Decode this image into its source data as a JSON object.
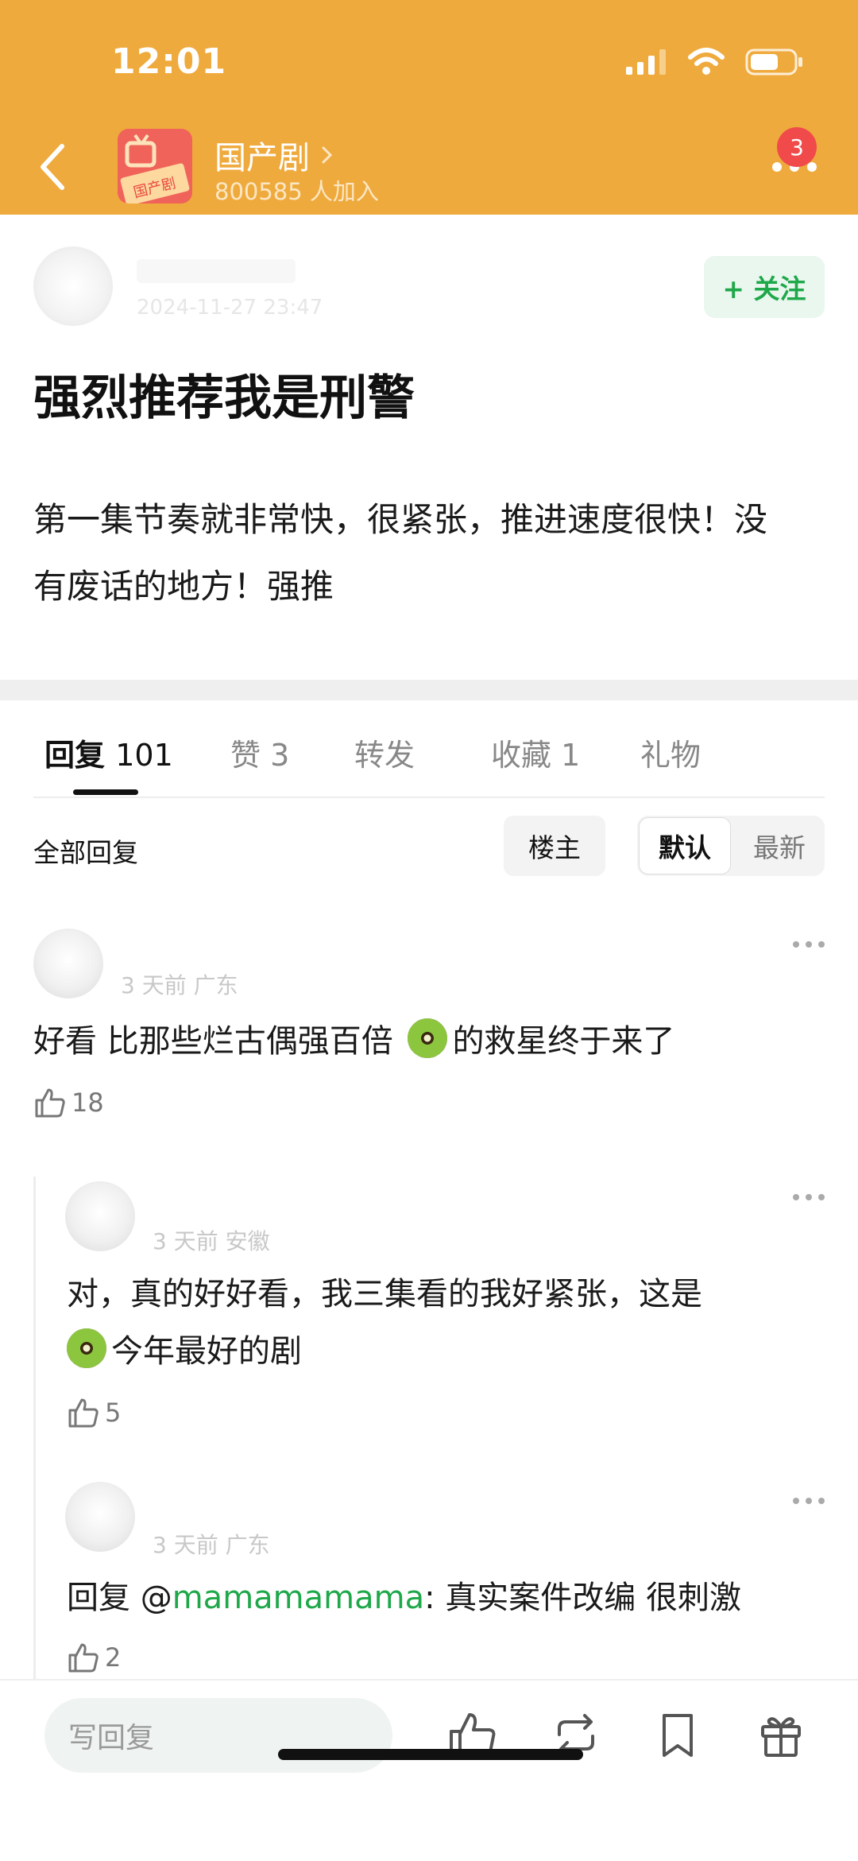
{
  "status_bar": {
    "time": "12:01"
  },
  "header": {
    "group_title": "国产剧",
    "members": "800585 人加入",
    "notification_count": "3",
    "logo_text": "国产剧"
  },
  "post": {
    "date": "2024-11-27 23:47",
    "follow_label": "+ 关注",
    "title": "强烈推荐我是刑警",
    "body": "第一集节奏就非常快，很紧张，推进速度很快！没有废话的地方！强推"
  },
  "tabs": [
    {
      "label": "回复",
      "count": "101"
    },
    {
      "label": "赞",
      "count": "3"
    },
    {
      "label": "转发",
      "count": ""
    },
    {
      "label": "收藏",
      "count": "1"
    },
    {
      "label": "礼物",
      "count": ""
    }
  ],
  "filter": {
    "all_replies": "全部回复",
    "louzhu": "楼主",
    "sort_default": "默认",
    "sort_new": "最新"
  },
  "comments": [
    {
      "meta": "3 天前  广东",
      "text_before": "好看 比那些烂古偶强百倍 ",
      "text_after": "的救星终于来了",
      "likes": "18"
    },
    {
      "meta": "3 天前  安徽",
      "text_line1": "对，真的好好看，我三集看的我好紧张，这是",
      "text_line2": "今年最好的剧",
      "likes": "5"
    },
    {
      "meta": "3 天前  广东",
      "reply_prefix": "回复 @",
      "mention": "mamamamama",
      "text": ": 真实案件改编 很刺激",
      "likes": "2"
    }
  ],
  "bottom_bar": {
    "reply_placeholder": "写回复"
  },
  "colors": {
    "header": "#EFAA3D",
    "accent_green": "#1FA84A",
    "badge_red": "#F04A4A"
  }
}
